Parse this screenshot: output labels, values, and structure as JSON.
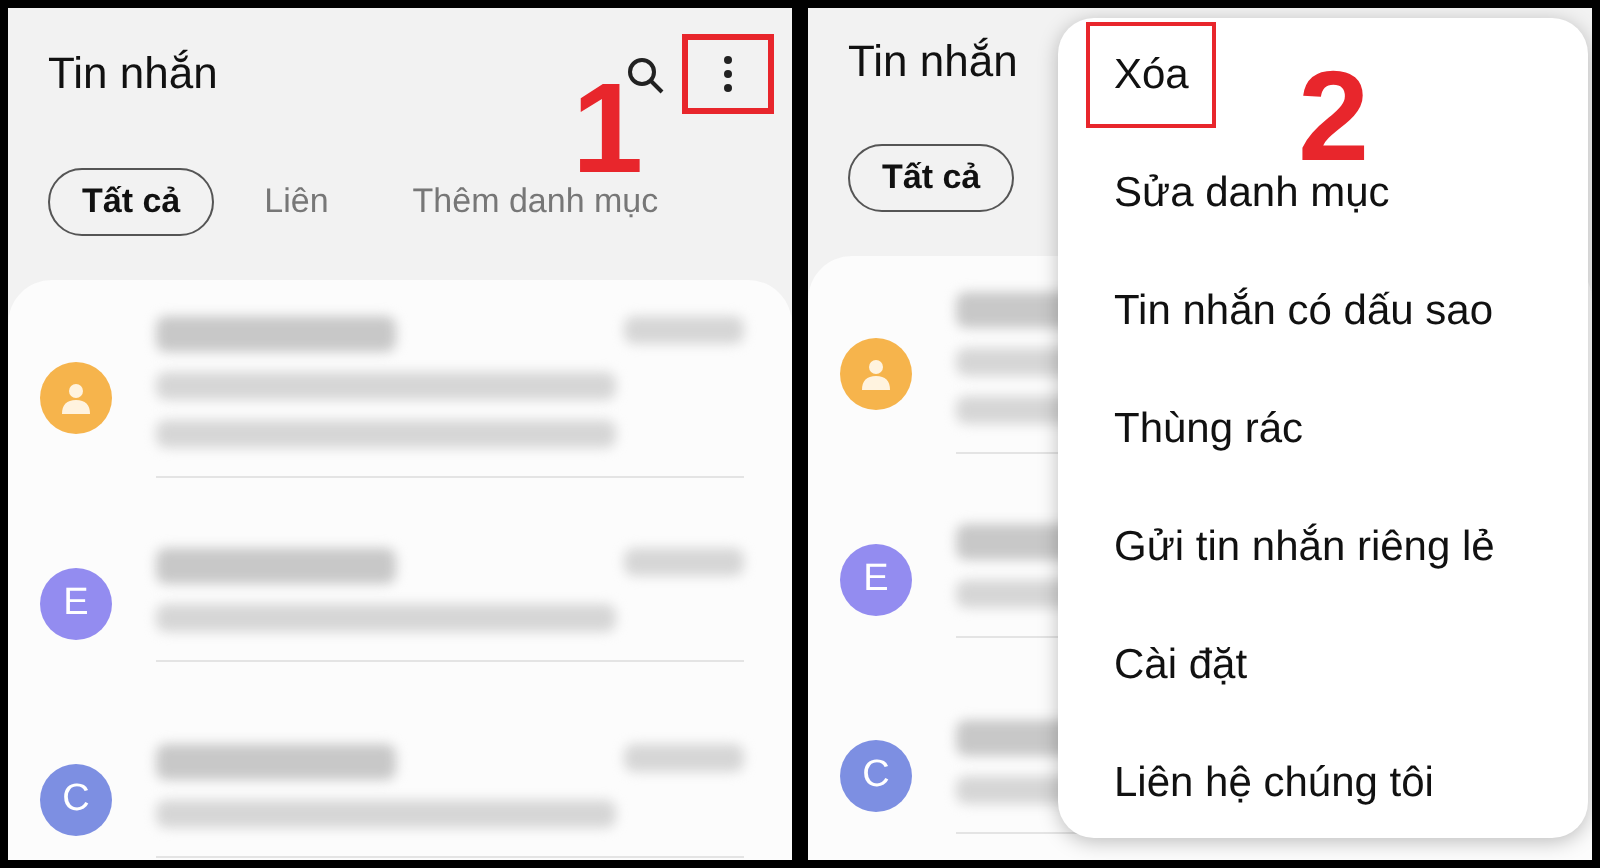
{
  "panels": [
    {
      "step": "1",
      "title": "Tin nhắn",
      "more_highlighted": true,
      "tabs": [
        {
          "label": "Tất cả",
          "selected": true
        },
        {
          "label": "Liên",
          "selected": false
        },
        {
          "label": "Thêm danh mục",
          "selected": false
        }
      ],
      "contacts": [
        {
          "kind": "person",
          "color": "#f6b44c"
        },
        {
          "kind": "letter",
          "letter": "E",
          "color": "#938cf0"
        },
        {
          "kind": "letter",
          "letter": "C",
          "color": "#7d8fe2"
        }
      ]
    },
    {
      "step": "2",
      "title": "Tin nhắn",
      "tabs": [
        {
          "label": "Tất cả",
          "selected": true
        }
      ],
      "contacts": [
        {
          "kind": "person",
          "color": "#f6b44c"
        },
        {
          "kind": "letter",
          "letter": "E",
          "color": "#938cf0"
        },
        {
          "kind": "letter",
          "letter": "C",
          "color": "#7d8fe2"
        }
      ],
      "menu": [
        {
          "label": "Xóa",
          "highlighted": true
        },
        {
          "label": "Sửa danh mục",
          "highlighted": false
        },
        {
          "label": "Tin nhắn có dấu sao",
          "highlighted": false
        },
        {
          "label": "Thùng rác",
          "highlighted": false
        },
        {
          "label": "Gửi tin nhắn riêng lẻ",
          "highlighted": false
        },
        {
          "label": "Cài đặt",
          "highlighted": false
        },
        {
          "label": "Liên hệ chúng tôi",
          "highlighted": false
        }
      ]
    }
  ]
}
